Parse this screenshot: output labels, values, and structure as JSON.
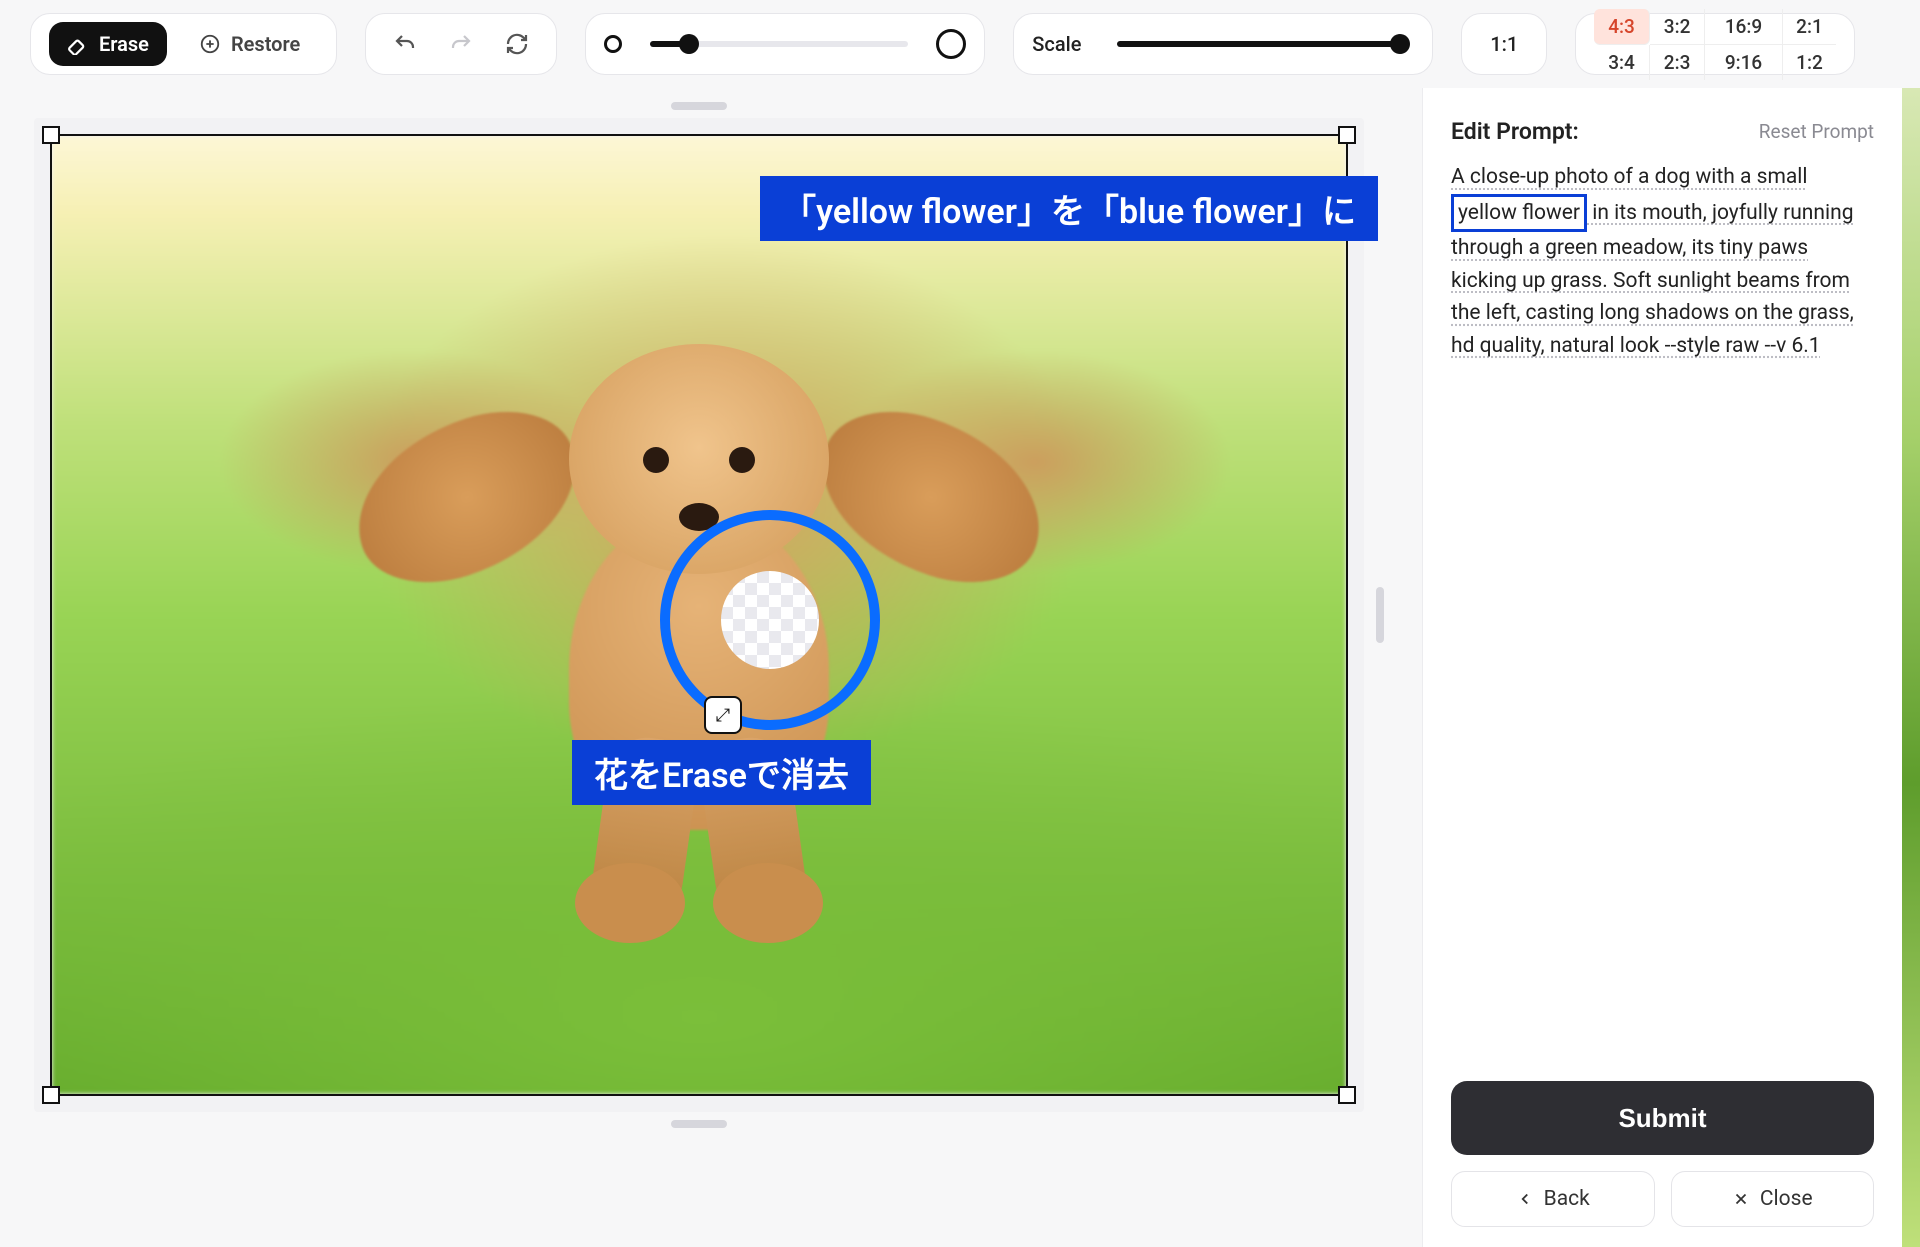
{
  "toolbar": {
    "erase_label": "Erase",
    "restore_label": "Restore",
    "scale_label": "Scale",
    "brush_size_pct": 15,
    "scale_pct": 100,
    "aspect_11": "1:1",
    "aspect_rows": [
      [
        "4:3",
        "3:2",
        "16:9",
        "2:1"
      ],
      [
        "3:4",
        "2:3",
        "9:16",
        "1:2"
      ]
    ],
    "aspect_active": "4:3"
  },
  "canvas": {
    "annotation_top": "「yellow flower」を「blue flower」に",
    "annotation_mid": "花をEraseで消去",
    "resize_glyph": "⤢"
  },
  "sidebar": {
    "title": "Edit Prompt:",
    "reset_label": "Reset Prompt",
    "prompt_pre": "A close-up photo of a dog with a small ",
    "prompt_highlight": "yellow flower",
    "prompt_post": " in its mouth, joyfully running through a green meadow, its tiny paws kicking up grass. Soft sunlight beams from the left, casting long shadows on the grass, hd quality, natural look --style raw --v 6.1",
    "submit_label": "Submit",
    "back_label": "Back",
    "close_label": "Close"
  }
}
